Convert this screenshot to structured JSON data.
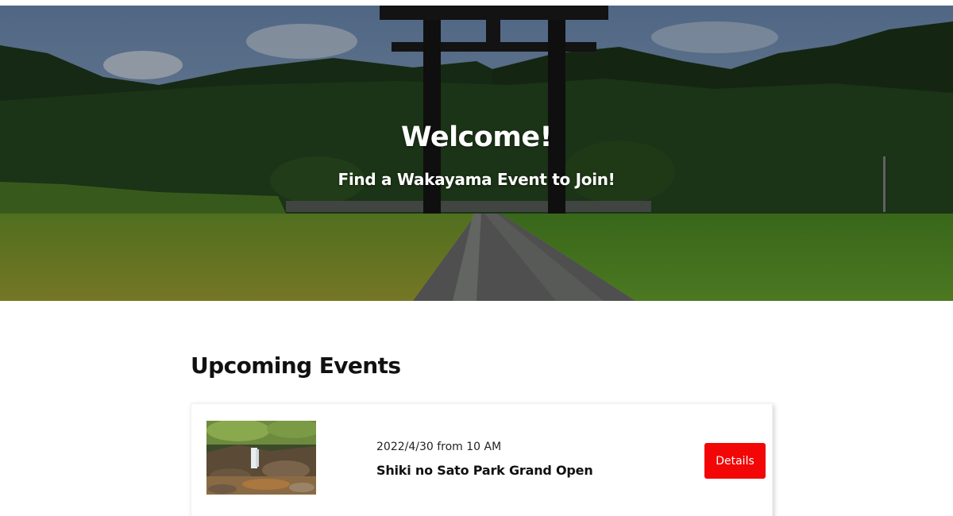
{
  "hero": {
    "title": "Welcome!",
    "subtitle": "Find a Wakayama Event to Join!"
  },
  "events_section": {
    "title": "Upcoming Events",
    "events": [
      {
        "date": "2022/4/30 from 10 AM",
        "name": "Shiki no Sato Park Grand Open",
        "button_label": "Details"
      }
    ]
  },
  "colors": {
    "accent": "#f20606",
    "text": "#111111"
  }
}
